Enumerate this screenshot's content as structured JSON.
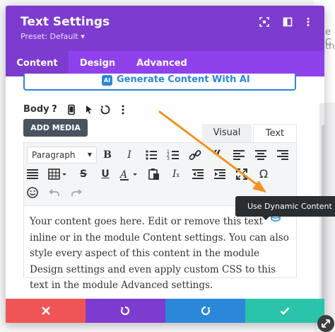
{
  "modal": {
    "title": "Text Settings",
    "preset": "Preset: Default ▾"
  },
  "tabs": [
    {
      "label": "Content"
    },
    {
      "label": "Design"
    },
    {
      "label": "Advanced"
    }
  ],
  "ai_button": {
    "label": "Generate Content With AI",
    "icon": "AI"
  },
  "body": {
    "label": "Body",
    "help_icon": "?"
  },
  "add_media": {
    "label": "ADD MEDIA"
  },
  "editor_tabs": [
    {
      "label": "Visual"
    },
    {
      "label": "Text"
    }
  ],
  "toolbar": {
    "format_value": "Paragraph"
  },
  "content_text": "Your content goes here. Edit or remove this text inline or in the module Content settings. You can also style every aspect of this content in the module Design settings and even apply custom CSS to this text in the module Advanced settings.",
  "tooltip": {
    "text": "Use Dynamic Content"
  },
  "background_text": [
    "e C",
    "th"
  ],
  "colors": {
    "header": "#7e3bd0",
    "tabs": "#8f42ec",
    "accent_blue": "#2b87da",
    "cancel": "#ef5555",
    "undo": "#7e3bd0",
    "redo": "#2b87da",
    "save": "#29c4a9",
    "annotation_arrow": "#f39221"
  }
}
